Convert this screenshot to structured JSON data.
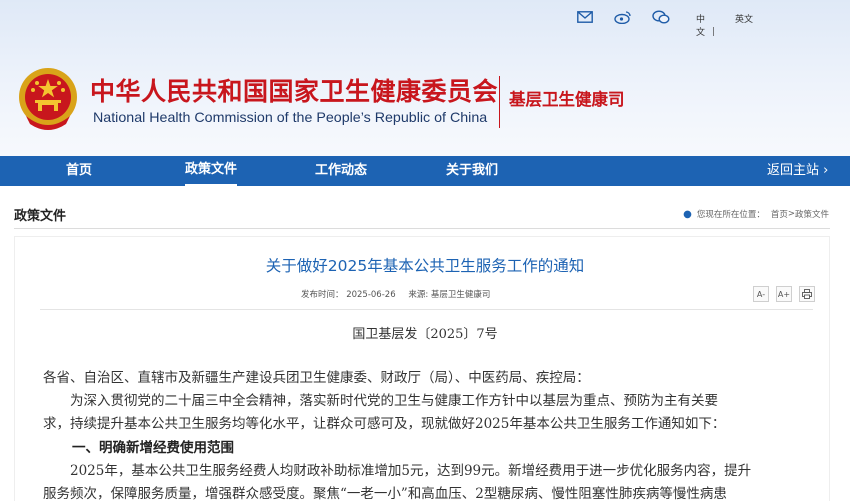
{
  "colors": {
    "brand_red": "#c8161d",
    "nav_blue": "#1d63b3"
  },
  "top_links": {
    "icons": [
      "mail-icon",
      "weibo-icon",
      "wechat-icon"
    ],
    "lang_cn": "中文",
    "lang_sep": "|",
    "lang_en": "英文"
  },
  "header": {
    "org_name_cn": "中华人民共和国国家卫生健康委员会",
    "org_name_en": "National Health Commission of the People’s Republic of China",
    "department": "基层卫生健康司"
  },
  "nav": {
    "items": [
      {
        "label": "首页"
      },
      {
        "label": "政策文件"
      },
      {
        "label": "工作动态"
      },
      {
        "label": "关于我们"
      }
    ],
    "back": "返回主站 ›"
  },
  "breadcrumb": {
    "section": "政策文件",
    "prefix": "您现在所在位置：",
    "home": "首页",
    "sep": ">",
    "current": "政策文件"
  },
  "article": {
    "title": "关于做好2025年基本公共卫生服务工作的通知",
    "date": "发布时间：  2025-06-26",
    "source": "来源: 基层卫生健康司",
    "tools": [
      "A-",
      "A+",
      "print-icon"
    ],
    "doc_number": "国卫基层发〔2025〕7号",
    "addressee": "各省、自治区、直辖市及新疆生产建设兵团卫生健康委、财政厅（局）、中医药局、疾控局：",
    "intro_line1": "　　为深入贯彻党的二十届三中全会精神，落实新时代党的卫生与健康工作方针中以基层为重点、预防为主有关要",
    "intro_line2": "求，持续提升基本公共卫生服务均等化水平，让群众可感可及，现就做好2025年基本公共卫生服务工作通知如下：",
    "heading1": "一、明确新增经费使用范围",
    "para1_line1": "　　2025年，基本公共卫生服务经费人均财政补助标准增加5元，达到99元。新增经费用于进一步优化服务内容，提升",
    "para1_line2": "服务频次，保障服务质量，增强群众感受度。聚焦“一老一小”和高血压、2型糖尿病、慢性阻塞性肺疾病等慢性病患"
  }
}
